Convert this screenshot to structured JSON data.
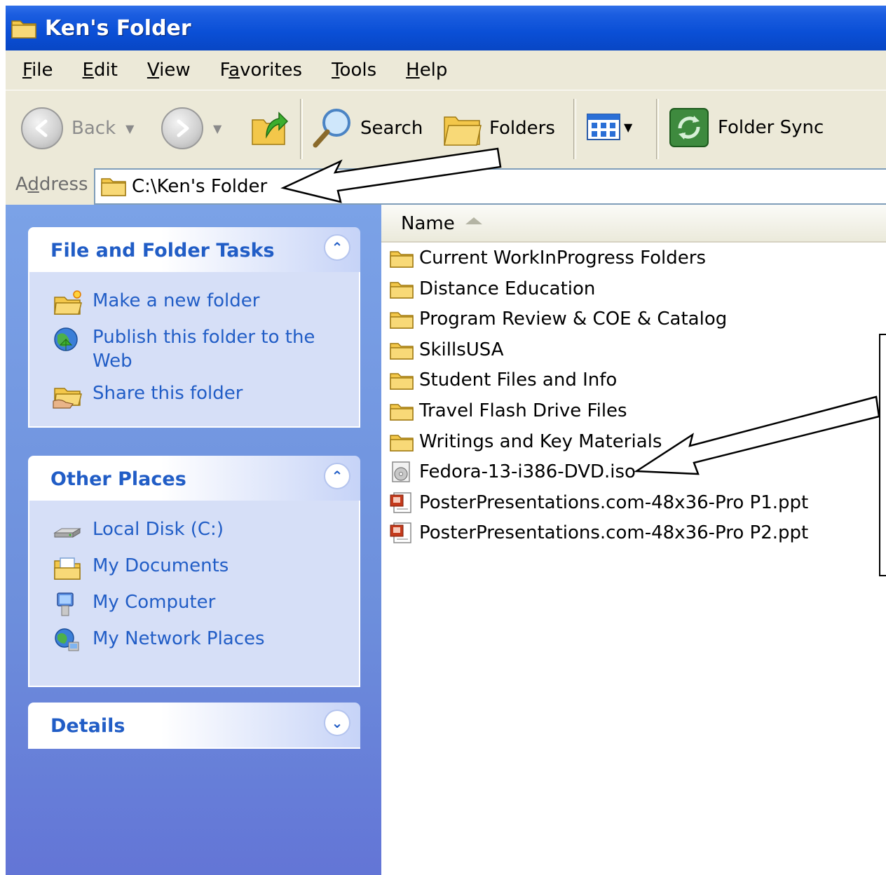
{
  "window": {
    "title": "Ken's Folder"
  },
  "menu": [
    {
      "label": "File",
      "key": "F",
      "rest": "ile"
    },
    {
      "label": "Edit",
      "key": "E",
      "rest": "dit"
    },
    {
      "label": "View",
      "key": "V",
      "rest": "iew"
    },
    {
      "label": "Favorites",
      "pre": "F",
      "key": "a",
      "rest": "vorites"
    },
    {
      "label": "Tools",
      "key": "T",
      "rest": "ools"
    },
    {
      "label": "Help",
      "key": "H",
      "rest": "elp"
    }
  ],
  "toolbar": {
    "back_label": "Back",
    "search_label": "Search",
    "folders_label": "Folders",
    "folder_sync_label": "Folder Sync"
  },
  "address": {
    "label_pre": "A",
    "label_key": "d",
    "label_rest": "dress",
    "value": "C:\\Ken's Folder"
  },
  "tasks": {
    "file_folder": {
      "title": "File and Folder Tasks",
      "items": [
        "Make a new folder",
        "Publish this folder to the Web",
        "Share this folder"
      ]
    },
    "other_places": {
      "title": "Other Places",
      "items": [
        "Local Disk (C:)",
        "My Documents",
        "My Computer",
        "My Network Places"
      ]
    },
    "details": {
      "title": "Details"
    }
  },
  "filelist": {
    "column_name": "Name",
    "files": [
      {
        "name": "Current WorkInProgress Folders",
        "type": "folder"
      },
      {
        "name": "Distance Education",
        "type": "folder"
      },
      {
        "name": "Program Review & COE & Catalog",
        "type": "folder"
      },
      {
        "name": "SkillsUSA",
        "type": "folder"
      },
      {
        "name": "Student Files and Info",
        "type": "folder"
      },
      {
        "name": "Travel Flash Drive Files",
        "type": "folder"
      },
      {
        "name": "Writings and Key Materials",
        "type": "folder"
      },
      {
        "name": "Fedora-13-i386-DVD.iso",
        "type": "iso"
      },
      {
        "name": "PosterPresentations.com-48x36-Pro P1.ppt",
        "type": "ppt"
      },
      {
        "name": "PosterPresentations.com-48x36-Pro P2.ppt",
        "type": "ppt"
      }
    ]
  },
  "colors": {
    "title_blue": "#0a4fd6",
    "task_link": "#215dc6",
    "chrome": "#ece9d8"
  }
}
